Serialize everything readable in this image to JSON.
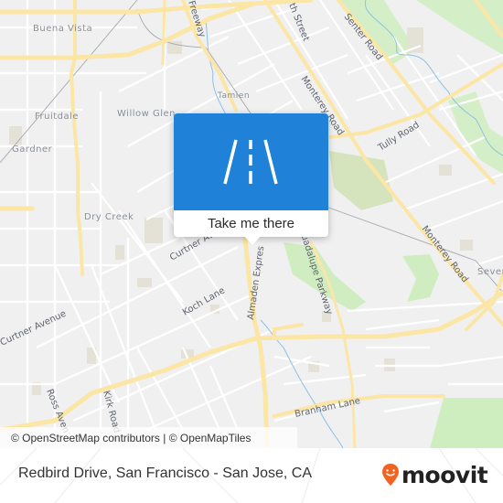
{
  "map": {
    "neighborhood_labels": [
      "Buena Vista",
      "Fruitdale",
      "Willow Glen",
      "Gardner",
      "Dry Creek",
      "Tamien",
      "Seven"
    ],
    "road_labels": [
      "Freeway",
      "th Street",
      "Senter Road",
      "Monterey Road",
      "Tully Road",
      "Curtner Ave",
      "Almaden Expres",
      "Guadalupe Parkway",
      "Koch Lane",
      "Curtner Avenue",
      "Ross Aven",
      "Kirk Road",
      "Branham Lane",
      "Monterey Road"
    ],
    "colors": {
      "background": "#f0f0f1",
      "major_road": "#fbe6a5",
      "park": "#cfeec0",
      "water": "#8cc0e8",
      "building_block": "#e3e0d2"
    }
  },
  "popup": {
    "icon": "road-icon",
    "action_label": "Take me there",
    "accent_color": "#1f82d8"
  },
  "attribution": "© OpenStreetMap contributors | © OpenMapTiles",
  "footer": {
    "location_title": "Redbird Drive, San Francisco - San Jose, CA",
    "brand": "moovit",
    "brand_color": "#f26322"
  }
}
